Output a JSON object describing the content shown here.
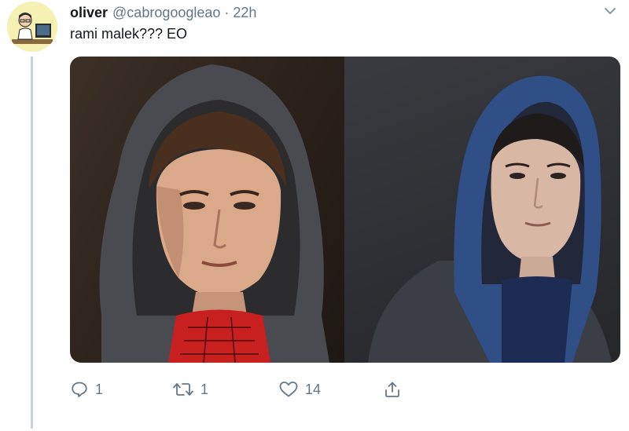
{
  "tweet": {
    "author_name": "oliver",
    "author_handle": "@cabrogoogleao",
    "separator": "·",
    "time": "22h",
    "text": "rami malek??? EO"
  },
  "media": {
    "photos": [
      "left-photo-hooded-boy-spiderman-shirt",
      "right-photo-hooded-man-blue-hoodie"
    ]
  },
  "actions": {
    "reply_count": "1",
    "retweet_count": "1",
    "like_count": "14"
  },
  "colors": {
    "text": "#14171a",
    "muted": "#657786",
    "thread_line": "#c9d3dc",
    "avatar_bg": "#f4f1b3"
  },
  "icons": [
    "chevron-down-icon",
    "reply-icon",
    "retweet-icon",
    "like-icon",
    "share-icon"
  ]
}
